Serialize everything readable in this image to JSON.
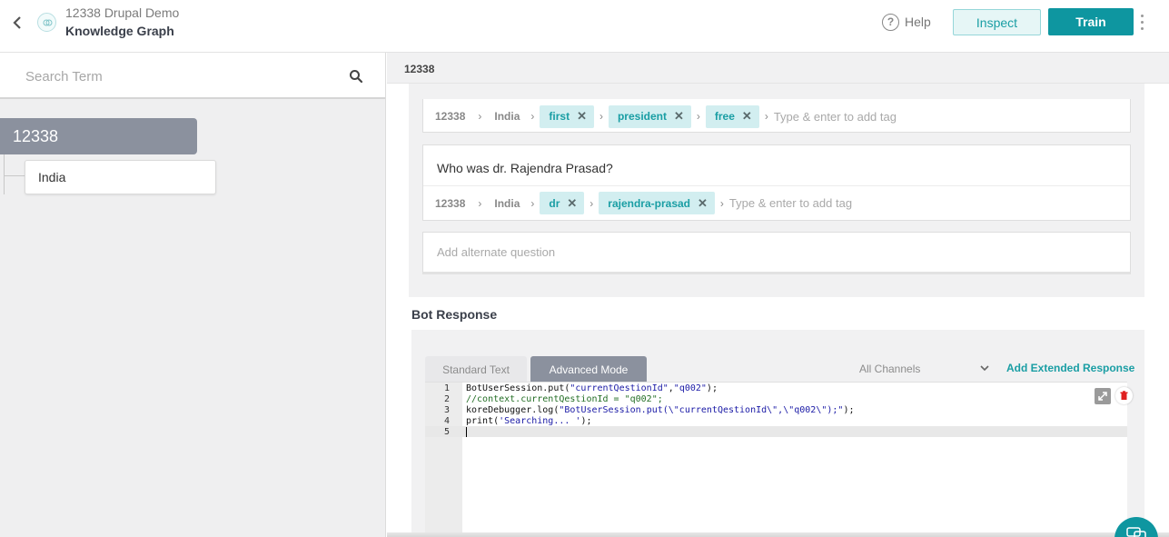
{
  "header": {
    "bot_name": "12338 Drupal Demo",
    "page_title": "Knowledge Graph",
    "help_label": "Help",
    "inspect_label": "Inspect",
    "train_label": "Train"
  },
  "left_panel": {
    "search_placeholder": "Search Term",
    "tree": {
      "root_label": "12338",
      "children": [
        "India"
      ]
    }
  },
  "right_panel": {
    "crumb": "12338",
    "questions": [
      {
        "text": "",
        "path": [
          "12338",
          "India"
        ],
        "tags": [
          "first",
          "president",
          "free"
        ],
        "tag_placeholder": "Type & enter to add tag"
      },
      {
        "text": "Who was dr. Rajendra Prasad?",
        "path": [
          "12338",
          "India"
        ],
        "tags": [
          "dr",
          "rajendra-prasad"
        ],
        "tag_placeholder": "Type & enter to add tag"
      }
    ],
    "alt_question_placeholder": "Add alternate question",
    "bot_response_label": "Bot Response",
    "tabs": [
      "Standard Text",
      "Advanced Mode"
    ],
    "active_tab": "Advanced Mode",
    "channels_selected": "All Channels",
    "add_extended_label": "Add Extended Response",
    "code_lines": [
      "BotUserSession.put(\"currentQestionId\",\"q002\");",
      "//context.currentQestionId = \"q002\";",
      "koreDebugger.log(\"BotUserSession.put(\\\"currentQestionId\\\",\\\"q002\\\");\");",
      "print('Searching... ');",
      ""
    ],
    "line_numbers": [
      "1",
      "2",
      "3",
      "4",
      "5"
    ]
  },
  "colors": {
    "accent": "#0e96a0",
    "chip_bg": "#d2eef0",
    "tree_root_bg": "#8b919e",
    "delete_red": "#e02020"
  },
  "icons": [
    "back-chevron-icon",
    "bot-logo-icon",
    "help-icon",
    "kebab-menu-icon",
    "search-icon",
    "chevron-right-icon",
    "close-icon",
    "chevron-down-icon",
    "expand-icon",
    "trash-icon",
    "chat-icon"
  ]
}
